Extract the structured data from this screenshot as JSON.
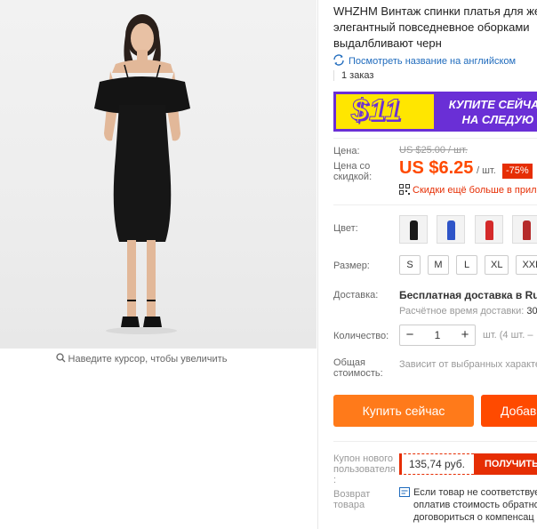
{
  "image": {
    "zoom_hint": "Наведите курсор, чтобы увеличить"
  },
  "product": {
    "title": "WHZHM Винтаж спинки платья для женщин элегантный повседневное оборками выдалбливают черн",
    "translate_link": "Посмотреть название на английском",
    "orders": "1 заказ"
  },
  "banner": {
    "big_text": "$11",
    "line1": "КУПИТЕ СЕЙЧАС",
    "line2": "НА СЛЕДУЮ"
  },
  "pricing": {
    "price_label": "Цена:",
    "old_price": "US $25.00 / шт.",
    "discount_price_label": "Цена со скидкой:",
    "price": "US $6.25",
    "unit": "/ шт.",
    "discount_badge": "-75%",
    "more_discounts": "Скидки ещё больше в прил"
  },
  "options": {
    "color_label": "Цвет:",
    "swatches": [
      {
        "name": "black",
        "color": "#1a1a1a"
      },
      {
        "name": "blue",
        "color": "#2f55c8"
      },
      {
        "name": "red",
        "color": "#d42a2a"
      },
      {
        "name": "burgundy",
        "color": "#b52c2c"
      }
    ],
    "size_label": "Размер:",
    "sizes": [
      "S",
      "M",
      "L",
      "XL",
      "XXL"
    ]
  },
  "shipping": {
    "label": "Доставка:",
    "main": "Бесплатная доставка в Russia",
    "time_label": "Расчётное время доставки:",
    "time_value": "30"
  },
  "quantity": {
    "label": "Количество:",
    "minus": "−",
    "value": "1",
    "plus": "+",
    "note": "шт. (4 шт. –"
  },
  "total": {
    "label": "Общая стоимость:",
    "value": "Зависит от выбранных характе"
  },
  "actions": {
    "buy_now": "Купить сейчас",
    "add_to_cart": "Добав"
  },
  "coupon": {
    "label": "Купон нового пользователя :",
    "value": "135,74 руб.",
    "button": "ПОЛУЧИТЬ"
  },
  "return": {
    "label": "Возврат товара",
    "line1": "Если товар не соответствуе",
    "line2": "оплатив стоимость обратно",
    "line3": "договориться о компенсац"
  },
  "colors": {
    "accent_orange": "#ff7a1a",
    "accent_red": "#ff4a00",
    "badge_red": "#e62e04",
    "banner_purple": "#6a2fd6",
    "banner_yellow": "#ffe600",
    "link_blue": "#1f6bbd"
  }
}
